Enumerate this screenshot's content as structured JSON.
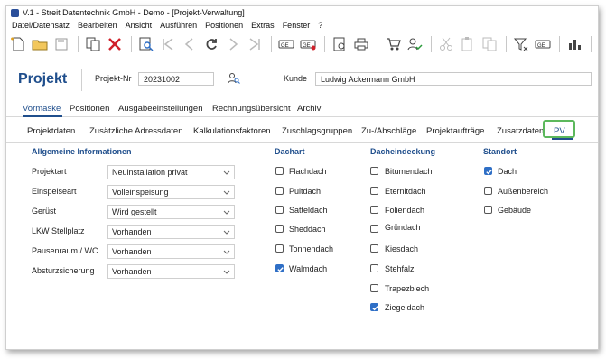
{
  "window": {
    "title": "V.1 - Streit Datentechnik GmbH - Demo - [Projekt-Verwaltung]"
  },
  "menu": [
    "Datei/Datensatz",
    "Bearbeiten",
    "Ansicht",
    "Ausführen",
    "Positionen",
    "Extras",
    "Fenster",
    "?"
  ],
  "header": {
    "title": "Projekt",
    "projekt_nr_label": "Projekt-Nr",
    "projekt_nr_value": "20231002",
    "kunde_label": "Kunde",
    "kunde_value": "Ludwig Ackermann GmbH"
  },
  "tabs_main": [
    "Vormaske",
    "Positionen",
    "Ausgabeeinstellungen",
    "Rechnungsübersicht",
    "Archiv"
  ],
  "tabs_sub": [
    "Projektdaten",
    "Zusätzliche Adressdaten",
    "Kalkulationsfaktoren",
    "Zuschlagsgruppen",
    "Zu-/Abschläge",
    "Projektaufträge",
    "Zusatzdaten",
    "PV"
  ],
  "allgemein": {
    "title": "Allgemeine Informationen",
    "rows": [
      {
        "label": "Projektart",
        "value": "Neuinstallation privat"
      },
      {
        "label": "Einspeiseart",
        "value": "Volleinspeisung"
      },
      {
        "label": "Gerüst",
        "value": "Wird gestellt"
      },
      {
        "label": "LKW Stellplatz",
        "value": "Vorhanden"
      },
      {
        "label": "Pausenraum / WC",
        "value": "Vorhanden"
      },
      {
        "label": "Absturzsicherung",
        "value": "Vorhanden"
      }
    ]
  },
  "dachart": {
    "title": "Dachart",
    "items": [
      {
        "label": "Flachdach",
        "checked": false
      },
      {
        "label": "Pultdach",
        "checked": false
      },
      {
        "label": "Satteldach",
        "checked": false
      },
      {
        "label": "Sheddach",
        "checked": false
      },
      {
        "label": "Tonnendach",
        "checked": false
      },
      {
        "label": "Walmdach",
        "checked": true
      }
    ]
  },
  "dacheindeckung": {
    "title": "Dacheindeckung",
    "items": [
      {
        "label": "Bitumendach",
        "checked": false
      },
      {
        "label": "Eternitdach",
        "checked": false
      },
      {
        "label": "Foliendach",
        "checked": false
      },
      {
        "label": "Gründach",
        "checked": false
      },
      {
        "label": "Kiesdach",
        "checked": false
      },
      {
        "label": "Stehfalz",
        "checked": false
      },
      {
        "label": "Trapezblech",
        "checked": false
      },
      {
        "label": "Ziegeldach",
        "checked": true
      }
    ]
  },
  "standort": {
    "title": "Standort",
    "items": [
      {
        "label": "Dach",
        "checked": true
      },
      {
        "label": "Außenbereich",
        "checked": false
      },
      {
        "label": "Gebäude",
        "checked": false
      }
    ]
  },
  "colors": {
    "accent": "#1f4e8c",
    "highlight": "#5cb85c",
    "check": "#2f6fc6"
  }
}
